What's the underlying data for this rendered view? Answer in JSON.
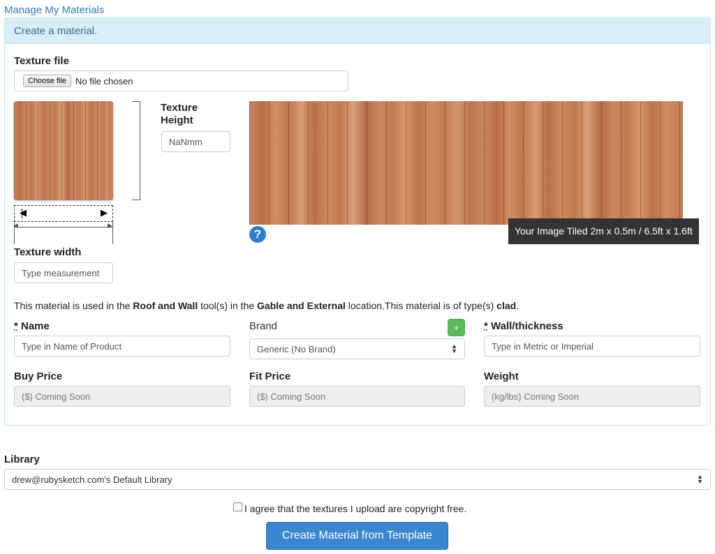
{
  "breadcrumb": {
    "manage_link": "Manage My Materials"
  },
  "panel": {
    "heading": "Create a material."
  },
  "texture_file": {
    "label": "Texture file",
    "choose_button": "Choose file",
    "status": "No file chosen"
  },
  "texture_height": {
    "label_line1": "Texture",
    "label_line2": "Height",
    "value": "NaNmm"
  },
  "texture_width": {
    "label": "Texture width",
    "placeholder": "Type measurement"
  },
  "tiled_preview": {
    "tooltip": "Your Image Tiled 2m x 0.5m / 6.5ft x 1.6ft"
  },
  "icons": {
    "help": "question-circle-icon",
    "plus": "plus-icon",
    "select_arrows": "up-down-arrows-icon",
    "left_arrow": "arrow-left-icon",
    "right_arrow": "arrow-right-icon"
  },
  "usage": {
    "part1": "This material is used in the ",
    "tools": "Roof and Wall",
    "part2": " tool(s) in the ",
    "locations": "Gable and External",
    "part3": " location.This material is of type(s) ",
    "types": "clad",
    "part4": "."
  },
  "name_field": {
    "required_mark": "*",
    "label": " Name",
    "placeholder": "Type in Name of Product"
  },
  "brand_field": {
    "label": "Brand",
    "selected": "Generic (No Brand)",
    "add_label": "+"
  },
  "wall_field": {
    "required_mark": "*",
    "label": " Wall/thickness",
    "placeholder": "Type in Metric or Imperial"
  },
  "buy_price": {
    "label": "Buy Price",
    "placeholder": "($) Coming Soon"
  },
  "fit_price": {
    "label": "Fit Price",
    "placeholder": "($) Coming Soon"
  },
  "weight": {
    "label": "Weight",
    "placeholder": "(kg/lbs) Coming Soon"
  },
  "library": {
    "label": "Library",
    "selected": "drew@rubysketch.com's Default Library"
  },
  "agreement": {
    "text": "I agree that the textures I upload are copyright free."
  },
  "submit": {
    "label": "Create Material from Template"
  },
  "colors": {
    "accent": "#337ab7",
    "panel_heading_bg": "#d9edf7",
    "submit_bg": "#3a87cf",
    "add_button": "#5cb85c"
  }
}
